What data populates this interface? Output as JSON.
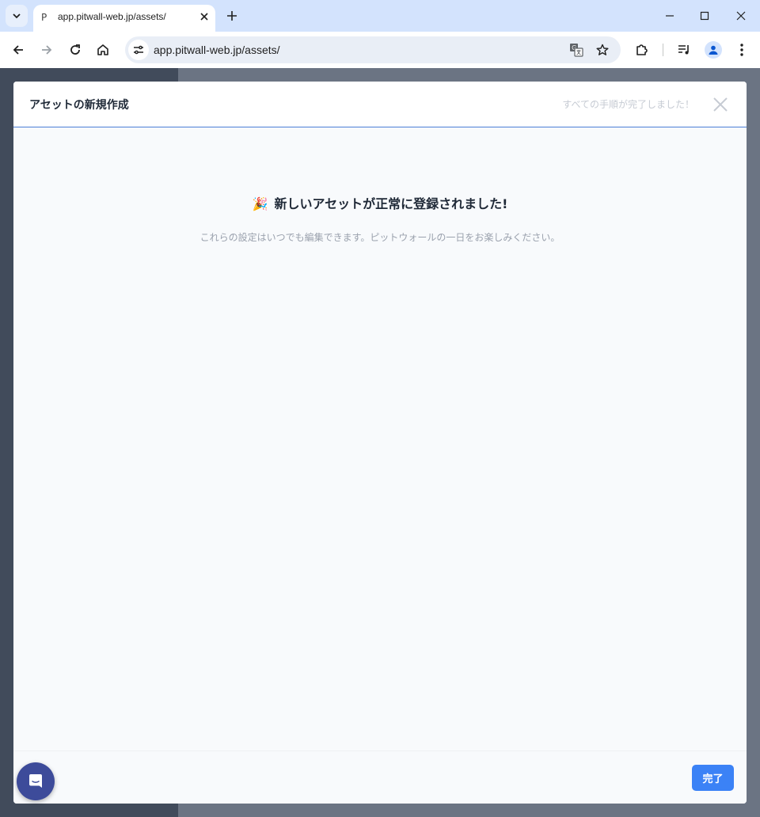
{
  "browser": {
    "tab": {
      "title": "app.pitwall-web.jp/assets/",
      "favicon": "P"
    },
    "url": "app.pitwall-web.jp/assets/",
    "icons": {
      "tab_search": "chevron-down-icon",
      "close_tab": "close-icon",
      "new_tab": "plus-icon",
      "minimize": "minimize-icon",
      "maximize": "maximize-icon",
      "close_window": "close-icon",
      "back": "arrow-left-icon",
      "forward": "arrow-right-icon",
      "reload": "reload-icon",
      "home": "home-icon",
      "site_info": "tune-icon",
      "translate": "translate-icon",
      "bookmark": "star-icon",
      "extensions": "puzzle-icon",
      "media": "media-queue-icon",
      "profile": "person-icon",
      "menu": "more-vert-icon"
    }
  },
  "modal": {
    "title": "アセットの新規作成",
    "status": "すべての手順が完了しました！",
    "success_emoji": "🎉",
    "success_heading": "新しいアセットが正常に登録されました!",
    "success_sub": "これらの設定はいつでも編集できます。ピットウォールの一日をお楽しみください。",
    "done_label": "完了"
  },
  "colors": {
    "accent": "#3b82f6",
    "header_rule": "#4c7fd6",
    "chat_launcher": "#3d4b9a",
    "tabstrip": "#d3e3fd"
  }
}
